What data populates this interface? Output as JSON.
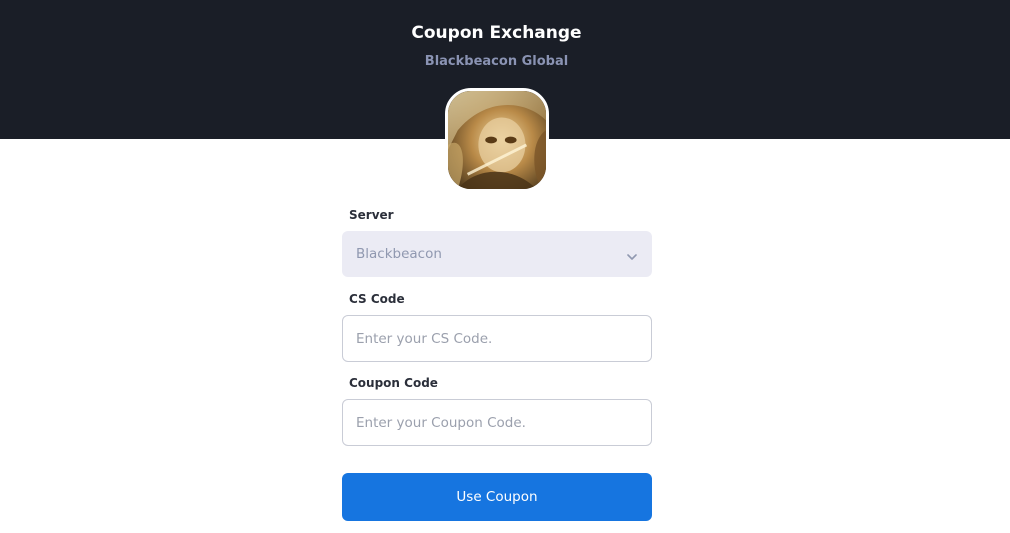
{
  "header": {
    "title": "Coupon Exchange",
    "subtitle": "Blackbeacon Global",
    "background_color": "#1a1e27",
    "game_icon": "anime-character-portrait-icon"
  },
  "form": {
    "server": {
      "label": "Server",
      "selected_value": "Blackbeacon"
    },
    "cs_code": {
      "label": "CS Code",
      "value": "",
      "placeholder": "Enter your CS Code."
    },
    "coupon_code": {
      "label": "Coupon Code",
      "value": "",
      "placeholder": "Enter your Coupon Code."
    },
    "submit_label": "Use Coupon",
    "accent_color": "#1675e0"
  }
}
